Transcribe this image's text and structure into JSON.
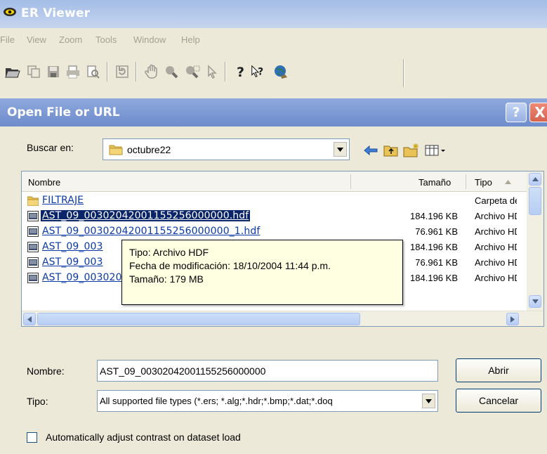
{
  "app": {
    "title": "ER Viewer",
    "menu": [
      "File",
      "View",
      "Zoom",
      "Tools",
      "Window",
      "Help"
    ]
  },
  "dialog": {
    "title": "Open File or URL",
    "help_label": "?",
    "close_label": "X",
    "look_in_label": "Buscar en:",
    "look_in_value": "octubre22",
    "columns": {
      "name": "Nombre",
      "size": "Tamaño",
      "type": "Tipo"
    },
    "files": [
      {
        "name": "FILTRAJE",
        "size": "",
        "type": "Carpeta de archivos",
        "kind": "folder"
      },
      {
        "name": "AST_09_00302042001155256000000.hdf",
        "size": "184.196 KB",
        "type": "Archivo HDF",
        "kind": "file",
        "selected": true
      },
      {
        "name": "AST_09_00302042001155256000000_1.hdf",
        "size": "76.961 KB",
        "type": "Archivo HDF",
        "kind": "file"
      },
      {
        "name": "AST_09_003",
        "size": "184.196 KB",
        "type": "Archivo HDF",
        "kind": "file"
      },
      {
        "name": "AST_09_003",
        "size": "76.961 KB",
        "type": "Archivo HDF",
        "kind": "file"
      },
      {
        "name": "AST_09_00302042001155314000000.hdf",
        "size": "184.196 KB",
        "type": "Archivo HDF",
        "kind": "file"
      }
    ],
    "tooltip": {
      "line1": "Tipo: Archivo HDF",
      "line2": "Fecha de modificación: 18/10/2004 11:44 p.m.",
      "line3": "Tamaño: 179 MB"
    },
    "filename_label": "Nombre:",
    "filename_value": "AST_09_00302042001155256000000",
    "filetype_label": "Tipo:",
    "filetype_value": "All supported file types (*.ers; *.alg;*.hdr;*.bmp;*.dat;*.doq",
    "open_label": "Abrir",
    "cancel_label": "Cancelar",
    "auto_contrast_label": "Automatically adjust contrast on dataset load",
    "auto_contrast_checked": false
  },
  "colors": {
    "selection": "#0a246a",
    "link": "#0a3aa6",
    "tooltip_bg": "#ffffe1",
    "dialog_title": "#7a97d3",
    "close_red": "#d6634f"
  },
  "icons": {
    "toolbar": [
      "open-folder-icon",
      "copy-icon",
      "save-icon",
      "print-icon",
      "print-preview-icon",
      "refresh-icon",
      "pan-hand-icon",
      "zoom-in-icon",
      "zoom-box-icon",
      "pointer-icon",
      "help-icon",
      "context-help-icon",
      "globe-icon"
    ]
  }
}
